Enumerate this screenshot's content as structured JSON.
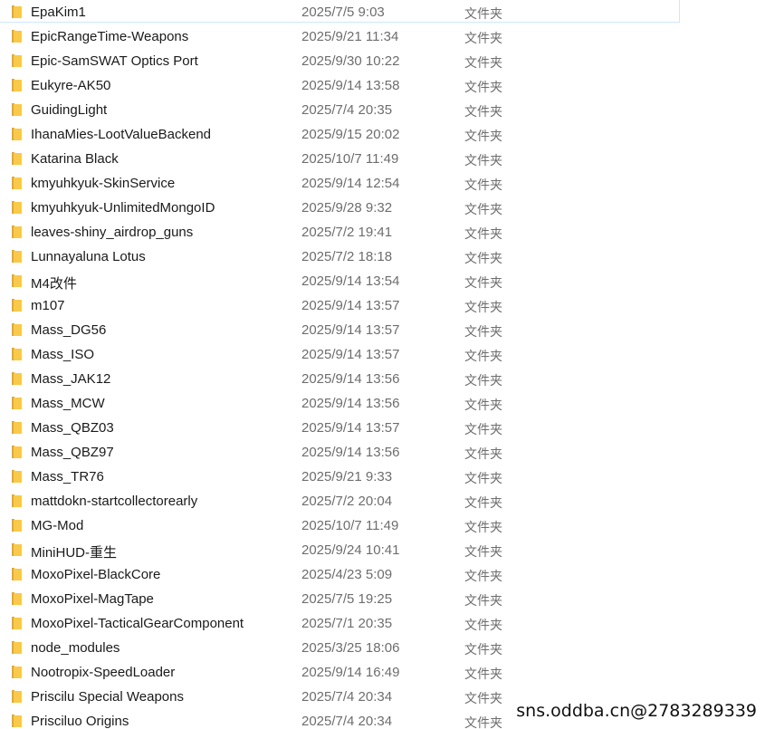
{
  "colors": {
    "folder_front": "#f8c94c",
    "folder_back": "#e3a92a",
    "name_text": "#1a1a1a",
    "meta_text": "#6d6d6d"
  },
  "icon": "folder-icon",
  "rows": [
    {
      "name": "EpaKim1",
      "date": "2025/7/5 9:03",
      "type": "文件夹"
    },
    {
      "name": "EpicRangeTime-Weapons",
      "date": "2025/9/21 11:34",
      "type": "文件夹"
    },
    {
      "name": "Epic-SamSWAT Optics Port",
      "date": "2025/9/30 10:22",
      "type": "文件夹"
    },
    {
      "name": "Eukyre-AK50",
      "date": "2025/9/14 13:58",
      "type": "文件夹"
    },
    {
      "name": "GuidingLight",
      "date": "2025/7/4 20:35",
      "type": "文件夹"
    },
    {
      "name": "IhanaMies-LootValueBackend",
      "date": "2025/9/15 20:02",
      "type": "文件夹"
    },
    {
      "name": "Katarina Black",
      "date": "2025/10/7 11:49",
      "type": "文件夹"
    },
    {
      "name": "kmyuhkyuk-SkinService",
      "date": "2025/9/14 12:54",
      "type": "文件夹"
    },
    {
      "name": "kmyuhkyuk-UnlimitedMongoID",
      "date": "2025/9/28 9:32",
      "type": "文件夹"
    },
    {
      "name": "leaves-shiny_airdrop_guns",
      "date": "2025/7/2 19:41",
      "type": "文件夹"
    },
    {
      "name": "Lunnayaluna Lotus",
      "date": "2025/7/2 18:18",
      "type": "文件夹"
    },
    {
      "name": "M4改件",
      "date": "2025/9/14 13:54",
      "type": "文件夹"
    },
    {
      "name": "m107",
      "date": "2025/9/14 13:57",
      "type": "文件夹"
    },
    {
      "name": "Mass_DG56",
      "date": "2025/9/14 13:57",
      "type": "文件夹"
    },
    {
      "name": "Mass_ISO",
      "date": "2025/9/14 13:57",
      "type": "文件夹"
    },
    {
      "name": "Mass_JAK12",
      "date": "2025/9/14 13:56",
      "type": "文件夹"
    },
    {
      "name": "Mass_MCW",
      "date": "2025/9/14 13:56",
      "type": "文件夹"
    },
    {
      "name": "Mass_QBZ03",
      "date": "2025/9/14 13:57",
      "type": "文件夹"
    },
    {
      "name": "Mass_QBZ97",
      "date": "2025/9/14 13:56",
      "type": "文件夹"
    },
    {
      "name": "Mass_TR76",
      "date": "2025/9/21 9:33",
      "type": "文件夹"
    },
    {
      "name": "mattdokn-startcollectorearly",
      "date": "2025/7/2 20:04",
      "type": "文件夹"
    },
    {
      "name": "MG-Mod",
      "date": "2025/10/7 11:49",
      "type": "文件夹"
    },
    {
      "name": "MiniHUD-重生",
      "date": "2025/9/24 10:41",
      "type": "文件夹"
    },
    {
      "name": "MoxoPixel-BlackCore",
      "date": "2025/4/23 5:09",
      "type": "文件夹"
    },
    {
      "name": "MoxoPixel-MagTape",
      "date": "2025/7/5 19:25",
      "type": "文件夹"
    },
    {
      "name": "MoxoPixel-TacticalGearComponent",
      "date": "2025/7/1 20:35",
      "type": "文件夹"
    },
    {
      "name": "node_modules",
      "date": "2025/3/25 18:06",
      "type": "文件夹"
    },
    {
      "name": "Nootropix-SpeedLoader",
      "date": "2025/9/14 16:49",
      "type": "文件夹"
    },
    {
      "name": "Priscilu Special Weapons",
      "date": "2025/7/4 20:34",
      "type": "文件夹"
    },
    {
      "name": "Prisciluo Origins",
      "date": "2025/7/4 20:34",
      "type": "文件夹"
    }
  ],
  "watermark": "sns.oddba.cn@2783289339"
}
